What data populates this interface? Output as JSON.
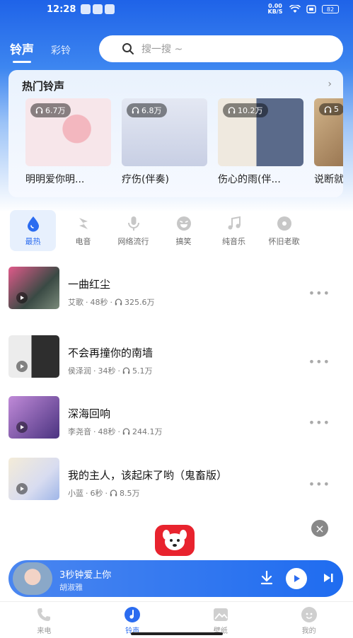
{
  "status_bar": {
    "time": "12:28",
    "net_speed": "0.00 KB/S",
    "battery": "82"
  },
  "header": {
    "tabs": [
      {
        "label": "铃声",
        "active": true
      },
      {
        "label": "彩铃",
        "active": false
      }
    ],
    "search_placeholder": "搜一搜 ~"
  },
  "hot": {
    "title": "热门铃声",
    "more_icon": "chevron-right-icon",
    "items": [
      {
        "name": "明明爱你明...",
        "plays": "6.7万",
        "colors": [
          "#f5d2d8",
          "#d45a6e"
        ]
      },
      {
        "name": "疗伤(伴奏)",
        "plays": "6.8万",
        "colors": [
          "#d9dff0",
          "#6a74a8"
        ]
      },
      {
        "name": "伤心的雨(伴...",
        "plays": "10.2万",
        "colors": [
          "#ece7dc",
          "#4a4540"
        ]
      },
      {
        "name": "说断就",
        "plays": "5",
        "colors": [
          "#c7a57c",
          "#6b4a2b"
        ]
      }
    ]
  },
  "categories": [
    {
      "label": "最热",
      "icon": "drop-icon",
      "active": true
    },
    {
      "label": "电音",
      "icon": "lightning-icon",
      "active": false
    },
    {
      "label": "网络流行",
      "icon": "microphone-icon",
      "active": false
    },
    {
      "label": "搞笑",
      "icon": "laugh-face-icon",
      "active": false
    },
    {
      "label": "纯音乐",
      "icon": "music-note-icon",
      "active": false
    },
    {
      "label": "怀旧老歌",
      "icon": "vinyl-disc-icon",
      "active": false
    }
  ],
  "songs": [
    {
      "title": "一曲红尘",
      "artist": "艾歌",
      "duration": "48秒",
      "plays": "325.6万",
      "colors": [
        "#e05a8a",
        "#2b3a3e"
      ]
    },
    {
      "title": "不会再撞你的南墙",
      "artist": "侯泽润",
      "duration": "34秒",
      "plays": "5.1万",
      "colors": [
        "#d8d8d8",
        "#3a3a3a"
      ]
    },
    {
      "title": "深海回响",
      "artist": "李尧音",
      "duration": "48秒",
      "plays": "244.1万",
      "colors": [
        "#b07ad0",
        "#3b2a6a"
      ]
    },
    {
      "title": "我的主人，该起床了哟（鬼畜版）",
      "artist": "小蓝",
      "duration": "6秒",
      "plays": "8.5万",
      "colors": [
        "#f4ecd8",
        "#9fb6e8"
      ]
    }
  ],
  "ad": {
    "close_label": "×"
  },
  "player": {
    "title": "3秒钟爱上你",
    "artist": "胡淑雅"
  },
  "bottom_nav": [
    {
      "label": "来电",
      "icon": "phone-call-icon",
      "active": false
    },
    {
      "label": "铃声",
      "icon": "music-note-icon",
      "active": true
    },
    {
      "label": "壁纸",
      "icon": "wallpaper-icon",
      "active": false
    },
    {
      "label": "我的",
      "icon": "profile-icon",
      "active": false
    }
  ],
  "colors": {
    "primary": "#2b6cf0",
    "ad_red": "#e8232e"
  }
}
